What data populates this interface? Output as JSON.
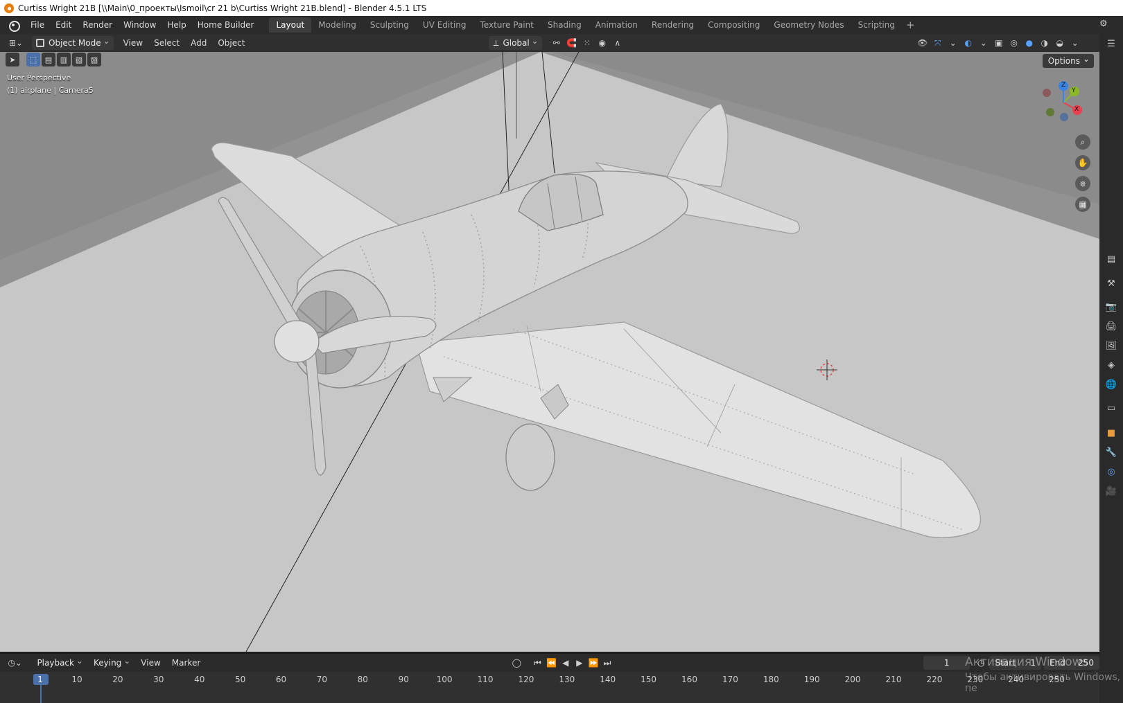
{
  "window": {
    "title": "Curtiss Wright 21B [\\\\Main\\0_проекты\\Ismoil\\cr 21 b\\Curtiss Wright 21B.blend] - Blender 4.5.1 LTS"
  },
  "menu": {
    "items": [
      "File",
      "Edit",
      "Render",
      "Window",
      "Help",
      "Home Builder"
    ]
  },
  "workspaces": {
    "tabs": [
      "Layout",
      "Modeling",
      "Sculpting",
      "UV Editing",
      "Texture Paint",
      "Shading",
      "Animation",
      "Rendering",
      "Compositing",
      "Geometry Nodes",
      "Scripting"
    ],
    "active": "Layout",
    "add_label": "+"
  },
  "viewport_header": {
    "mode": "Object Mode",
    "menus": [
      "View",
      "Select",
      "Add",
      "Object"
    ],
    "transform_orientation": "Global"
  },
  "viewport": {
    "perspective_label": "User Perspective",
    "object_label": "(1) airplane | Camera5",
    "options_label": "Options",
    "gizmo": {
      "x": "X",
      "y": "Y",
      "z": "Z"
    }
  },
  "timeline": {
    "menus": [
      "Playback",
      "Keying",
      "View",
      "Marker"
    ],
    "current_frame": "1",
    "start_label": "Start",
    "start_value": "1",
    "end_label": "End",
    "end_value": "250",
    "ticks": [
      "1",
      "10",
      "20",
      "30",
      "40",
      "50",
      "60",
      "70",
      "80",
      "90",
      "100",
      "110",
      "120",
      "130",
      "140",
      "150",
      "160",
      "170",
      "180",
      "190",
      "200",
      "210",
      "220",
      "230",
      "240",
      "250"
    ]
  },
  "os_watermark": {
    "line1": "Активация Windows",
    "line2": "Чтобы активировать Windows, пе"
  },
  "colors": {
    "accent": "#4b6fa8",
    "axis_x": "#e8414f",
    "axis_y": "#8cb826",
    "axis_z": "#3b83e0"
  }
}
